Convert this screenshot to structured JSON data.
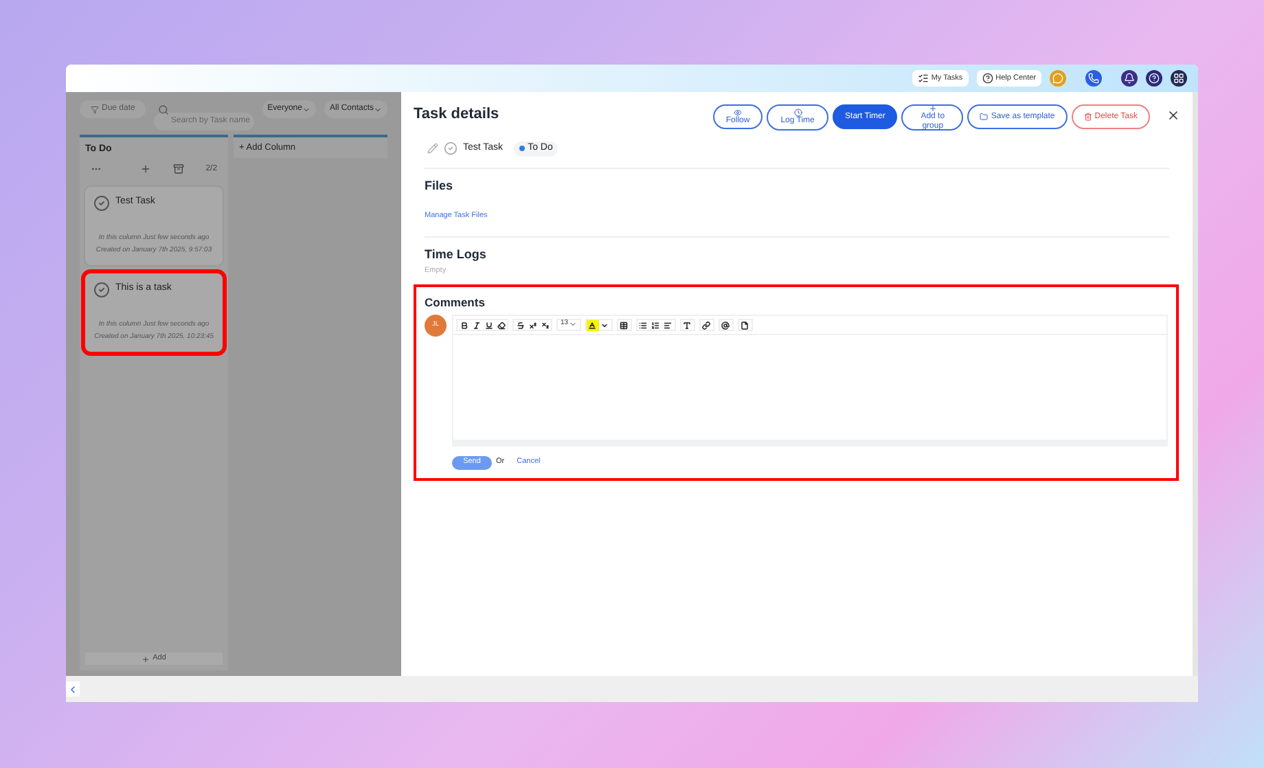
{
  "top_bar": {
    "links": [
      "My Tasks",
      "Help Center"
    ]
  },
  "board": {
    "filters": {
      "due_date": "Due date",
      "search_placeholder": "Search by Task name",
      "assignee": "Everyone",
      "contacts": "All Contacts"
    },
    "columns": [
      {
        "title": "To Do",
        "count": "2/2",
        "add_label": "Add",
        "tasks": [
          {
            "title": "Test Task",
            "moved": "In this column Just few seconds ago",
            "created": "Created on January 7th 2025, 9:57:03",
            "highlighted": false
          },
          {
            "title": "This is a task",
            "moved": "In this column Just few seconds ago",
            "created": "Created on January 7th 2025, 10:23:45",
            "highlighted": true
          }
        ]
      }
    ],
    "add_column": "+ Add Column"
  },
  "task_details": {
    "title": "Task details",
    "actions": [
      {
        "label": "Follow",
        "kind": "outline"
      },
      {
        "label": "Log Time",
        "kind": "outline"
      },
      {
        "label": "Start Timer",
        "kind": "primary"
      },
      {
        "label": "Add to group",
        "kind": "outline"
      },
      {
        "label": "Save as template",
        "kind": "outline"
      },
      {
        "label": "Delete Task",
        "kind": "danger"
      }
    ],
    "task_name": "Test Task",
    "status": "To Do",
    "files": {
      "heading": "Files",
      "link": "Manage Task Files"
    },
    "time_logs": {
      "heading": "Time Logs",
      "empty": "Empty"
    },
    "comments": {
      "heading": "Comments",
      "highlighted": true,
      "avatar": "JL",
      "font_size": "13",
      "send": "Send",
      "or": "Or",
      "cancel": "Cancel"
    }
  }
}
